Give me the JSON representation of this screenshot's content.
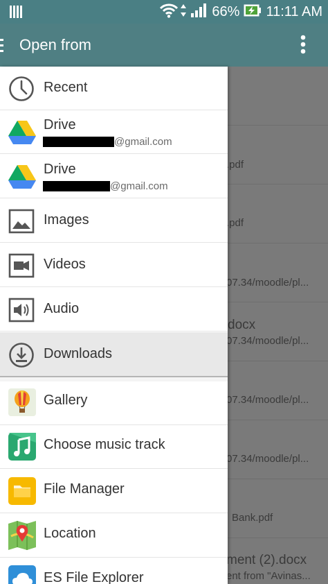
{
  "status_bar": {
    "battery_percent": "66%",
    "time": "11:11 AM"
  },
  "app_bar": {
    "title": "Open from"
  },
  "background_list": {
    "snippets": [
      ".pdf",
      ".pdf",
      "07.34/moodle/pl...",
      "docx",
      "07.34/moodle/pl...",
      "07.34/moodle/pl...",
      "07.34/moodle/pl...",
      "Bank.pdf",
      "ment (2).docx",
      "ent from \"Avinas..."
    ]
  },
  "drawer": {
    "items": [
      {
        "label": "Recent",
        "icon": "clock-icon"
      },
      {
        "label": "Drive",
        "sub": "@gmail.com",
        "icon": "google-drive-icon"
      },
      {
        "label": "Drive",
        "sub": "@gmail.com",
        "icon": "google-drive-icon"
      },
      {
        "label": "Images",
        "icon": "image-icon"
      },
      {
        "label": "Videos",
        "icon": "video-camera-icon"
      },
      {
        "label": "Audio",
        "icon": "speaker-icon"
      },
      {
        "label": "Downloads",
        "icon": "download-icon"
      },
      {
        "label": "Gallery",
        "icon": "balloon-icon"
      },
      {
        "label": "Choose music track",
        "icon": "music-note-icon"
      },
      {
        "label": "File Manager",
        "icon": "folder-icon"
      },
      {
        "label": "Location",
        "icon": "map-pin-icon"
      },
      {
        "label": "ES File Explorer",
        "icon": "cloud-folder-icon"
      }
    ],
    "selected_index": 6
  },
  "colors": {
    "app_bar": "#4f7f83",
    "drawer_bg": "#ffffff",
    "selected_bg": "#e8e8e8",
    "scrim": "#7a7a7a"
  }
}
